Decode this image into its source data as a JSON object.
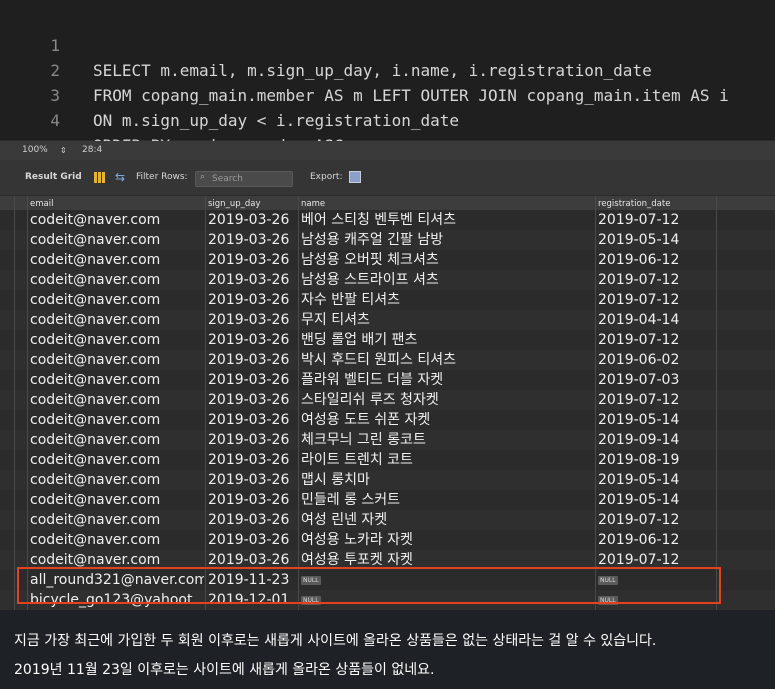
{
  "editor": {
    "lines": [
      {
        "num": "1",
        "text": "SELECT m.email, m.sign_up_day, i.name, i.registration_date"
      },
      {
        "num": "2",
        "text": "FROM copang_main.member AS m LEFT OUTER JOIN copang_main.item AS i"
      },
      {
        "num": "3",
        "text": "ON m.sign_up_day < i.registration_date"
      },
      {
        "num": "4",
        "text": "ORDER BY m.sign_up_day ASC;"
      }
    ],
    "zoom": "100%",
    "cursor_pos": "28:4"
  },
  "toolbar": {
    "result_grid_label": "Result Grid",
    "filter_rows_label": "Filter Rows:",
    "search_placeholder": "Search",
    "export_label": "Export:"
  },
  "columns": [
    "email",
    "sign_up_day",
    "name",
    "registration_date"
  ],
  "rows": [
    [
      "codeit@naver.com",
      "2019-03-26",
      "베어 스티칭 벤투벤 티셔츠",
      "2019-07-12"
    ],
    [
      "codeit@naver.com",
      "2019-03-26",
      "남성용 캐주얼 긴팔 남방",
      "2019-05-14"
    ],
    [
      "codeit@naver.com",
      "2019-03-26",
      "남성용 오버핏 체크셔츠",
      "2019-06-12"
    ],
    [
      "codeit@naver.com",
      "2019-03-26",
      "남성용 스트라이프 셔츠",
      "2019-07-12"
    ],
    [
      "codeit@naver.com",
      "2019-03-26",
      "자수 반팔 티셔츠",
      "2019-07-12"
    ],
    [
      "codeit@naver.com",
      "2019-03-26",
      "무지 티셔츠",
      "2019-04-14"
    ],
    [
      "codeit@naver.com",
      "2019-03-26",
      "밴딩 롤업 배기 팬츠",
      "2019-07-12"
    ],
    [
      "codeit@naver.com",
      "2019-03-26",
      "박시 후드티 원피스 티셔츠",
      "2019-06-02"
    ],
    [
      "codeit@naver.com",
      "2019-03-26",
      "플라워 벨티드 더블 자켓",
      "2019-07-03"
    ],
    [
      "codeit@naver.com",
      "2019-03-26",
      "스타일리쉬 루즈 청자켓",
      "2019-07-12"
    ],
    [
      "codeit@naver.com",
      "2019-03-26",
      "여성용 도트 쉬폰 자켓",
      "2019-05-14"
    ],
    [
      "codeit@naver.com",
      "2019-03-26",
      "체크무늬 그린 롱코트",
      "2019-09-14"
    ],
    [
      "codeit@naver.com",
      "2019-03-26",
      "라이트 트렌치 코트",
      "2019-08-19"
    ],
    [
      "codeit@naver.com",
      "2019-03-26",
      "맵시 롱치마",
      "2019-05-14"
    ],
    [
      "codeit@naver.com",
      "2019-03-26",
      "민들레 롱 스커트",
      "2019-05-14"
    ],
    [
      "codeit@naver.com",
      "2019-03-26",
      "여성 린넨 자켓",
      "2019-07-12"
    ],
    [
      "codeit@naver.com",
      "2019-03-26",
      "여성용 노카라 자켓",
      "2019-06-12"
    ],
    [
      "codeit@naver.com",
      "2019-03-26",
      "여성용 투포켓 자켓",
      "2019-07-12"
    ],
    [
      "all_round321@naver.com",
      "2019-11-23",
      "NULL",
      "NULL"
    ],
    [
      "bicycle_go123@yahoot...",
      "2019-12-01",
      "NULL",
      "NULL"
    ]
  ],
  "caption": {
    "line1": "지금 가장 최근에 가입한 두 회원 이후로는 새롭게 사이트에 올라온 상품들은 없는 상태라는 걸 알 수 있습니다.",
    "line2": "2019년 11월 23일 이후로는 사이트에 새롭게 올라온 상품들이 없네요."
  },
  "colors": {
    "highlight": "#e4421e",
    "editor_bg": "#1f1f1f",
    "grid_bg": "#2b2b2b"
  }
}
